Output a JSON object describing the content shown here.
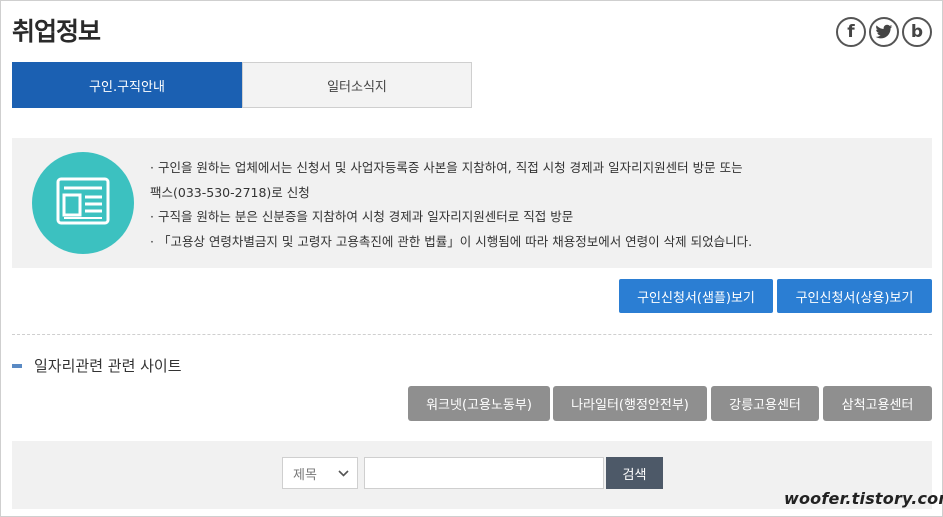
{
  "page": {
    "title": "취업정보"
  },
  "social": {
    "facebook_glyph": "f",
    "blog_glyph": "b"
  },
  "tabs": [
    {
      "label": "구인.구직안내",
      "active": true
    },
    {
      "label": "일터소식지",
      "active": false
    }
  ],
  "info": {
    "icon": "newspaper-icon",
    "icon_color": "#3cc1c0",
    "lines": [
      "· 구인을 원하는 업체에서는 신청서 및 사업자등록증 사본을 지참하여, 직접 시청 경제과 일자리지원센터 방문 또는",
      "팩스(033-530-2718)로 신청",
      "· 구직을 원하는 분은 신분증을 지참하여 시청 경제과 일자리지원센터로 직접 방문",
      "· 「고용상 연령차별금지 및 고령자 고용촉진에 관한 법률」이 시행됨에 따라 채용정보에서 연령이 삭제 되었습니다."
    ]
  },
  "form_buttons": [
    "구인신청서(샘플)보기",
    "구인신청서(상용)보기"
  ],
  "sites": {
    "title": "일자리관련 관련 사이트",
    "buttons": [
      "워크넷(고용노동부)",
      "나라일터(행정안전부)",
      "강릉고용센터",
      "삼척고용센터"
    ]
  },
  "search": {
    "select_value": "제목",
    "input_value": "",
    "button_label": "검색"
  },
  "watermark": "woofer.tistory.com",
  "colors": {
    "tab_active": "#1b60b2",
    "blue_button": "#2b7ed3",
    "gray_button": "#8f8f8f",
    "search_button": "#4d5968"
  }
}
